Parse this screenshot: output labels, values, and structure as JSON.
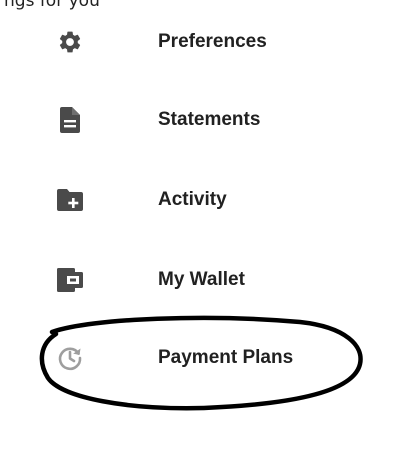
{
  "header": {
    "caption_fragment": "ngs for you"
  },
  "menu": {
    "items": [
      {
        "label": "Preferences",
        "icon": "gear-icon"
      },
      {
        "label": "Statements",
        "icon": "document-icon"
      },
      {
        "label": "Activity",
        "icon": "folder-plus-icon"
      },
      {
        "label": "My Wallet",
        "icon": "wallet-icon"
      },
      {
        "label": "Payment Plans",
        "icon": "clock-refresh-icon"
      }
    ]
  },
  "colors": {
    "icon": "#4a4a4a",
    "icon_light": "#9e9e9e",
    "text": "#212121",
    "annotation": "#000000"
  }
}
